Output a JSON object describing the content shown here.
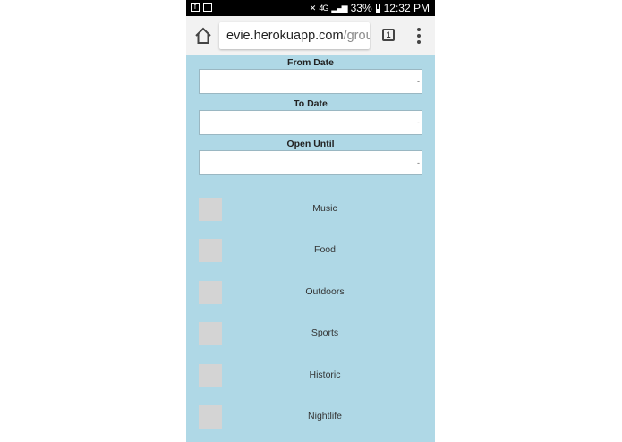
{
  "status_bar": {
    "battery": "33%",
    "time": "12:32 PM",
    "network": "4G"
  },
  "browser": {
    "url_host": "evie.herokuapp.com",
    "url_path": "/group",
    "tab_count": "1"
  },
  "form": {
    "from_date_label": "From Date",
    "to_date_label": "To Date",
    "open_until_label": "Open Until"
  },
  "categories": [
    {
      "label": "Music"
    },
    {
      "label": "Food"
    },
    {
      "label": "Outdoors"
    },
    {
      "label": "Sports"
    },
    {
      "label": "Historic"
    },
    {
      "label": "Nightlife"
    }
  ],
  "colors": {
    "page_background": "#afd8e6",
    "checkbox_fill": "#d4d4d4",
    "status_bar": "#000000"
  }
}
